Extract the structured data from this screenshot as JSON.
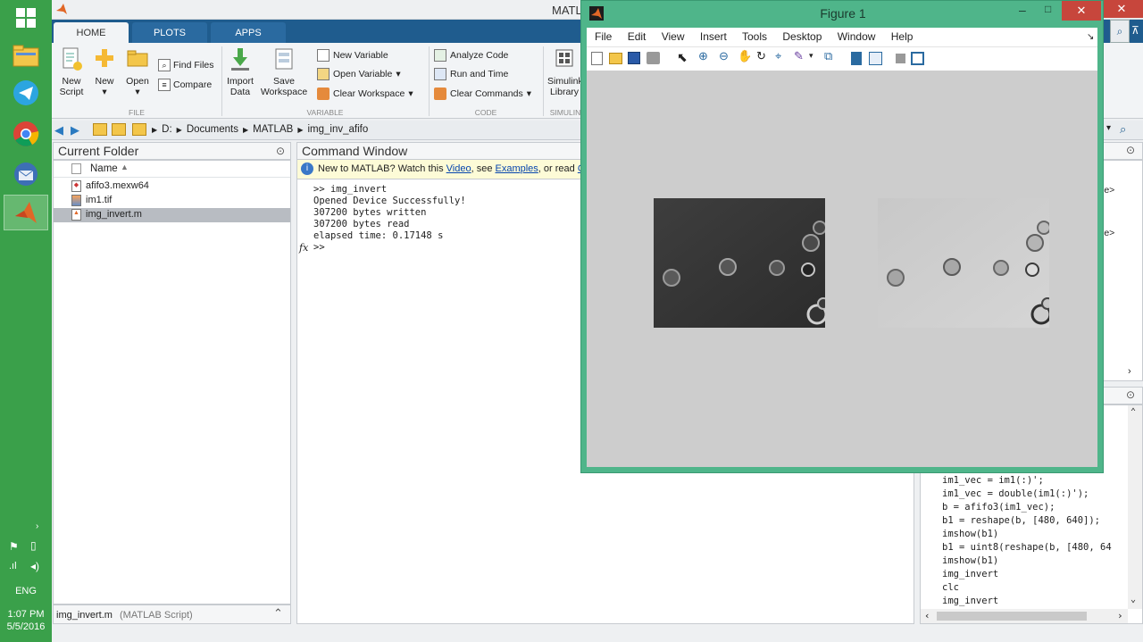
{
  "taskbar": {
    "time": "1:07 PM",
    "date": "5/5/2016",
    "lang": "ENG"
  },
  "matlab": {
    "title": "MATL",
    "tabs": [
      {
        "label": "HOME"
      },
      {
        "label": "PLOTS"
      },
      {
        "label": "APPS"
      }
    ],
    "ribbon": {
      "new_script_1": "New",
      "new_script_2": "Script",
      "new_1": "New",
      "open_1": "Open",
      "find_files": "Find Files",
      "compare": "Compare",
      "import_1": "Import",
      "import_2": "Data",
      "save_1": "Save",
      "save_2": "Workspace",
      "new_variable": "New Variable",
      "open_variable": "Open Variable",
      "clear_workspace": "Clear Workspace",
      "analyze_code": "Analyze Code",
      "run_and_time": "Run and Time",
      "clear_commands": "Clear Commands",
      "simulink_1": "Simulink",
      "simulink_2": "Library",
      "sec_file": "FILE",
      "sec_variable": "VARIABLE",
      "sec_code": "CODE",
      "sec_simulink": "SIMULIN"
    },
    "path": [
      "D:",
      "Documents",
      "MATLAB",
      "img_inv_afifo"
    ],
    "current_folder": {
      "title": "Current Folder",
      "col_name": "Name",
      "files": [
        {
          "name": "afifo3.mexw64"
        },
        {
          "name": "im1.tif"
        },
        {
          "name": "img_invert.m"
        }
      ],
      "details": "img_invert.m",
      "details_type": "(MATLAB Script)"
    },
    "command_window": {
      "title": "Command Window",
      "info_prefix": "New to MATLAB? Watch this ",
      "info_video": "Video",
      "info_mid": ", see ",
      "info_examples": "Examples",
      "info_suffix": ", or read ",
      "info_g": "G",
      "lines": [
        ">> img_invert",
        "Opened Device Successfully!",
        "307200 bytes written",
        "307200 bytes read",
        "elapsed time: 0.17148 s"
      ],
      "prompt": ">>",
      "fx": "fx"
    },
    "workspace_partial": [
      "le>",
      "le>"
    ],
    "history": [
      "im1_vec = im1(:)';",
      "im1_vec = double(im1(:)');",
      "b = afifo3(im1_vec);",
      "b1 = reshape(b, [480, 640]);",
      "imshow(b1)",
      "b1 = uint8(reshape(b, [480, 64",
      "imshow(b1)",
      "img_invert",
      "clc",
      "img_invert"
    ]
  },
  "figure": {
    "title": "Figure 1",
    "menu": [
      "File",
      "Edit",
      "View",
      "Insert",
      "Tools",
      "Desktop",
      "Window",
      "Help"
    ]
  }
}
